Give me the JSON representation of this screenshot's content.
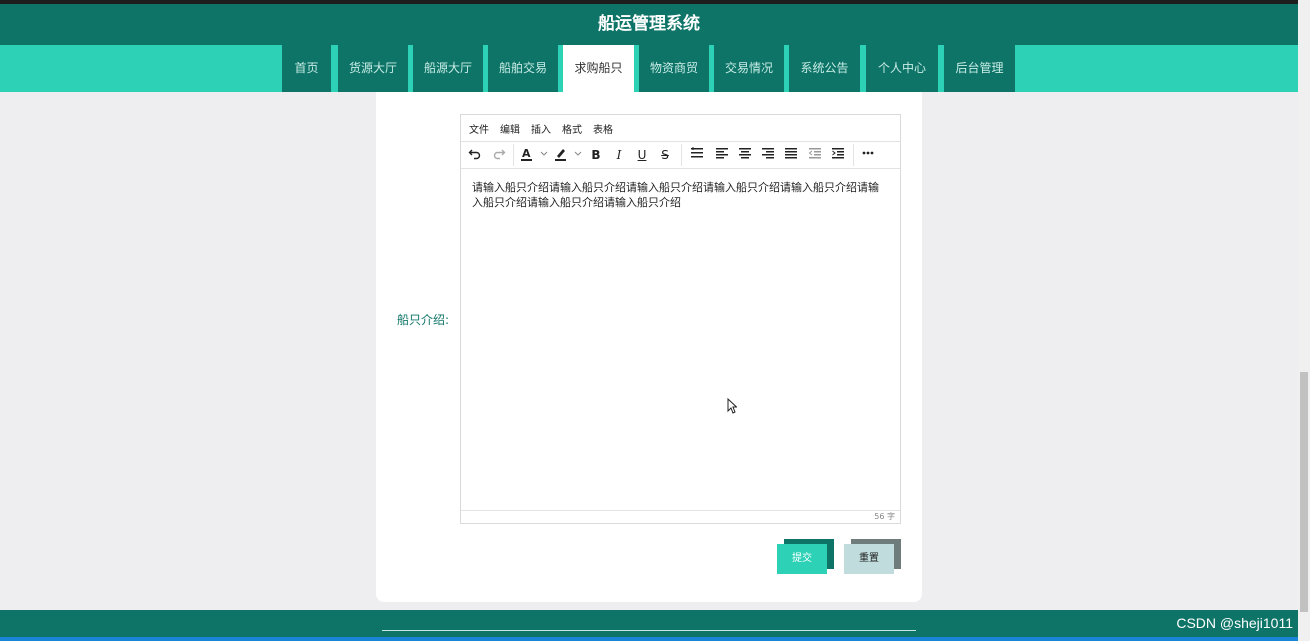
{
  "app": {
    "title": "船运管理系统"
  },
  "nav": {
    "items": [
      {
        "label": "首页",
        "active": false
      },
      {
        "label": "货源大厅",
        "active": false
      },
      {
        "label": "船源大厅",
        "active": false
      },
      {
        "label": "船舶交易",
        "active": false
      },
      {
        "label": "求购船只",
        "active": true
      },
      {
        "label": "物资商贸",
        "active": false
      },
      {
        "label": "交易情况",
        "active": false
      },
      {
        "label": "系统公告",
        "active": false
      },
      {
        "label": "个人中心",
        "active": false
      },
      {
        "label": "后台管理",
        "active": false
      }
    ]
  },
  "form": {
    "field_label": "船只介绍:",
    "editor": {
      "menu": [
        "文件",
        "编辑",
        "插入",
        "格式",
        "表格"
      ],
      "toolbar_icons": [
        "undo-icon",
        "redo-icon",
        "font-color-icon",
        "highlight-icon",
        "bold-icon",
        "italic-icon",
        "underline-icon",
        "strikethrough-icon",
        "line-height-icon",
        "align-left-icon",
        "align-center-icon",
        "align-right-icon",
        "align-justify-icon",
        "outdent-icon",
        "indent-icon",
        "more-icon"
      ],
      "content": "请输入船只介绍请输入船只介绍请输入船只介绍请输入船只介绍请输入船只介绍请输入船只介绍请输入船只介绍请输入船只介绍",
      "word_count": "56 字"
    },
    "submit_label": "提交",
    "reset_label": "重置"
  },
  "watermark": "CSDN @sheji1011",
  "colors": {
    "primary": "#0d7467",
    "accent": "#2dd1b6",
    "reset_bg": "#c0dcdc",
    "reset_shadow": "#6e7d7c"
  }
}
